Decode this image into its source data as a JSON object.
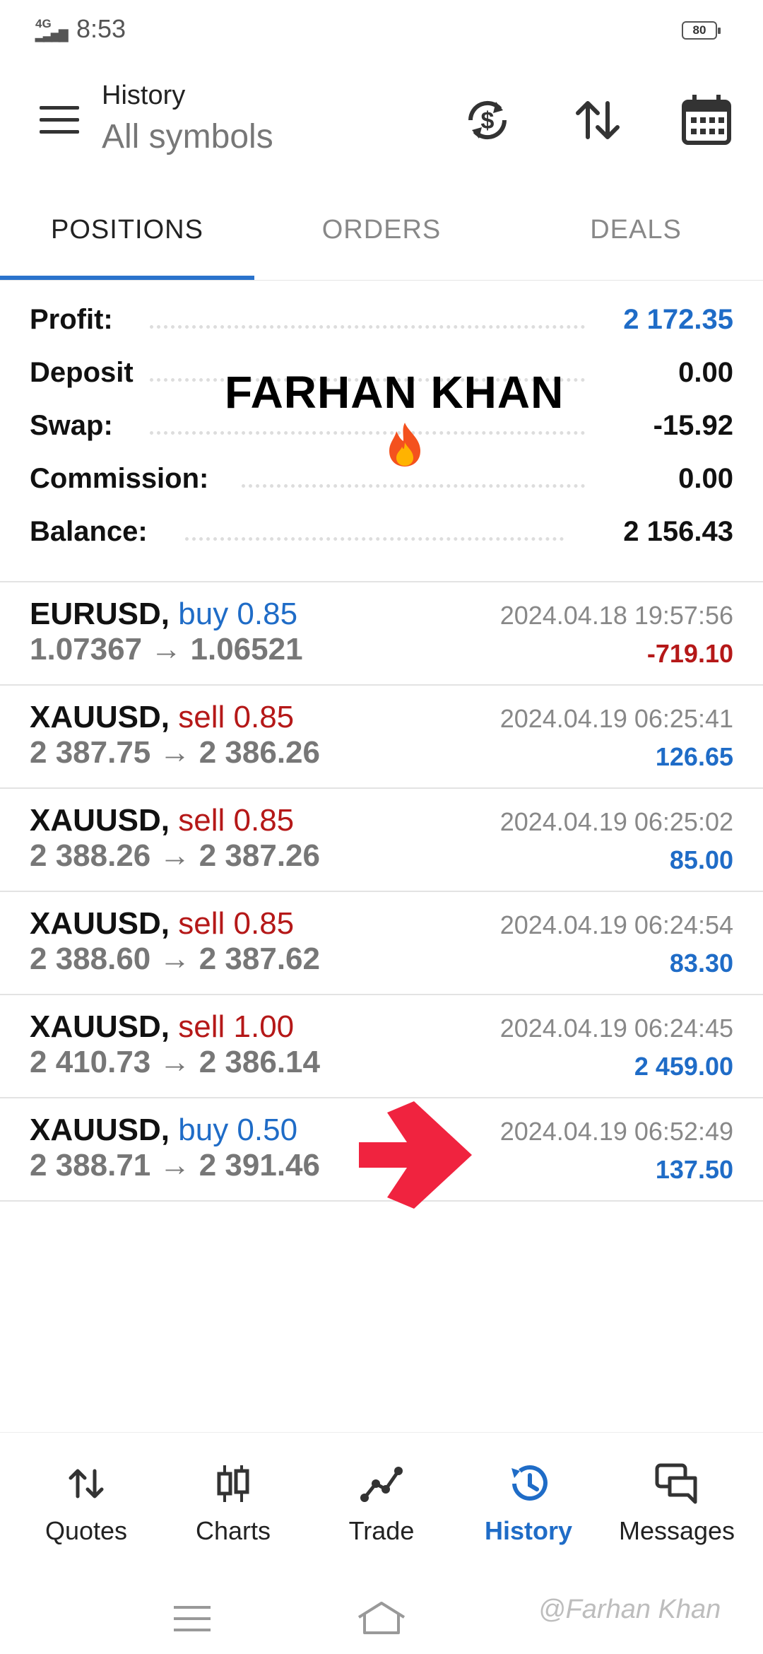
{
  "status_bar": {
    "network": "4G",
    "time": "8:53",
    "battery": "80"
  },
  "header": {
    "title": "History",
    "subtitle": "All symbols",
    "icons": [
      "currency-exchange-icon",
      "sort-arrows-icon",
      "calendar-icon"
    ]
  },
  "tabs": [
    {
      "label": "POSITIONS",
      "active": true
    },
    {
      "label": "ORDERS",
      "active": false
    },
    {
      "label": "DEALS",
      "active": false
    }
  ],
  "summary": {
    "profit": {
      "label": "Profit:",
      "value": "2 172.35"
    },
    "deposit": {
      "label": "Deposit",
      "value": "0.00"
    },
    "swap": {
      "label": "Swap:",
      "value": "-15.92"
    },
    "commission": {
      "label": "Commission:",
      "value": "0.00"
    },
    "balance": {
      "label": "Balance:",
      "value": "2 156.43"
    }
  },
  "overlay": {
    "name": "FARHAN KHAN",
    "icon": "fire-icon"
  },
  "positions": [
    {
      "symbol": "EURUSD,",
      "side": "buy 0.85",
      "side_color": "blue",
      "prices": "1.07367 → 1.06521",
      "time": "2024.04.18 19:57:56",
      "pl": "-719.10",
      "pl_color": "red"
    },
    {
      "symbol": "XAUUSD,",
      "side": "sell 0.85",
      "side_color": "red",
      "prices": "2 387.75 → 2 386.26",
      "time": "2024.04.19 06:25:41",
      "pl": "126.65",
      "pl_color": "blue"
    },
    {
      "symbol": "XAUUSD,",
      "side": "sell 0.85",
      "side_color": "red",
      "prices": "2 388.26 → 2 387.26",
      "time": "2024.04.19 06:25:02",
      "pl": "85.00",
      "pl_color": "blue"
    },
    {
      "symbol": "XAUUSD,",
      "side": "sell 0.85",
      "side_color": "red",
      "prices": "2 388.60 → 2 387.62",
      "time": "2024.04.19 06:24:54",
      "pl": "83.30",
      "pl_color": "blue"
    },
    {
      "symbol": "XAUUSD,",
      "side": "sell 1.00",
      "side_color": "red",
      "prices": "2 410.73 → 2 386.14",
      "time": "2024.04.19 06:24:45",
      "pl": "2 459.00",
      "pl_color": "blue"
    },
    {
      "symbol": "XAUUSD,",
      "side": "buy 0.50",
      "side_color": "blue",
      "prices": "2 388.71 → 2 391.46",
      "time": "2024.04.19 06:52:49",
      "pl": "137.50",
      "pl_color": "blue"
    }
  ],
  "bottom_nav": [
    {
      "label": "Quotes",
      "icon": "quotes-arrows-icon",
      "active": false
    },
    {
      "label": "Charts",
      "icon": "candlestick-icon",
      "active": false
    },
    {
      "label": "Trade",
      "icon": "trade-line-icon",
      "active": false
    },
    {
      "label": "History",
      "icon": "history-clock-icon",
      "active": true
    },
    {
      "label": "Messages",
      "icon": "messages-icon",
      "active": false
    }
  ],
  "credit": "@Farhan Khan",
  "colors": {
    "accent": "#2a73cc",
    "buy": "#1f6cc7",
    "sell": "#b51818",
    "arrow": "#f0233f"
  }
}
